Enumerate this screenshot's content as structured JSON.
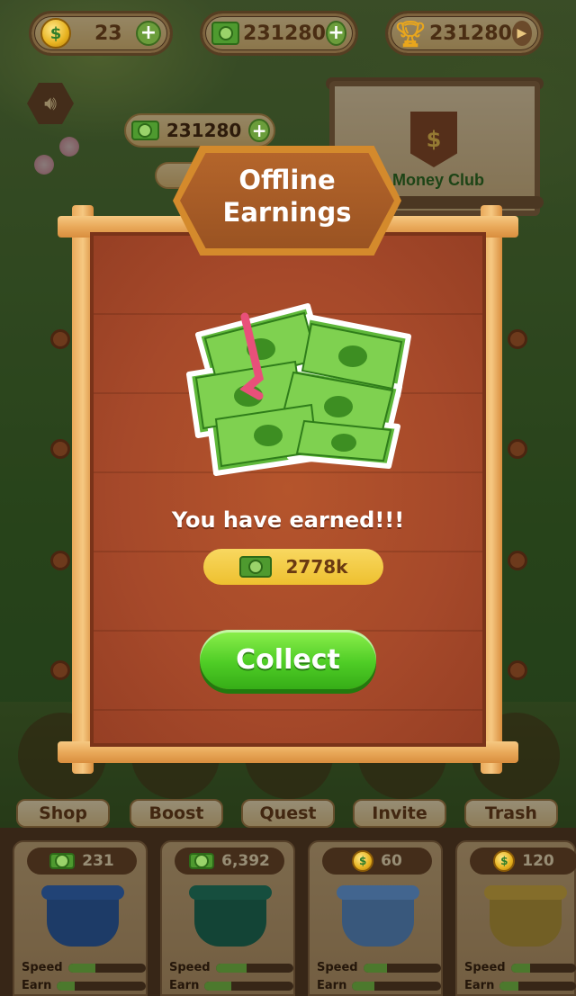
{
  "top_bar": {
    "coins": "23",
    "cash": "231280",
    "trophy": "231280"
  },
  "hud": {
    "cash_secondary": "231280"
  },
  "club_sign": {
    "label": "n Money Club",
    "banner_symbol": "$"
  },
  "modal": {
    "title_line1": "Offline",
    "title_line2": "Earnings",
    "message": "You have earned!!!",
    "reward_amount": "2778k",
    "collect_label": "Collect"
  },
  "bottom_nav": [
    {
      "label": "Shop"
    },
    {
      "label": "Boost"
    },
    {
      "label": "Quest"
    },
    {
      "label": "Invite"
    },
    {
      "label": "Trash"
    }
  ],
  "pots": [
    {
      "price": "231",
      "currency": "cash",
      "color": "#2f5fa6",
      "speed_fill": 0.35,
      "earn_fill": 0.2
    },
    {
      "price": "6,392",
      "currency": "cash",
      "color": "#1f6e58",
      "speed_fill": 0.4,
      "earn_fill": 0.3
    },
    {
      "price": "60",
      "currency": "coin",
      "color": "#5d8fc9",
      "speed_fill": 0.3,
      "earn_fill": 0.25
    },
    {
      "price": "120",
      "currency": "coin",
      "color": "#b99a3c",
      "speed_fill": 0.3,
      "earn_fill": 0.25
    }
  ],
  "stat_labels": {
    "speed": "Speed",
    "earn": "Earn"
  },
  "colors": {
    "board": "#a6492a",
    "frame": "#f0b56a",
    "collect_green": "#4fcd26",
    "reward_yellow": "#f3c93f"
  }
}
